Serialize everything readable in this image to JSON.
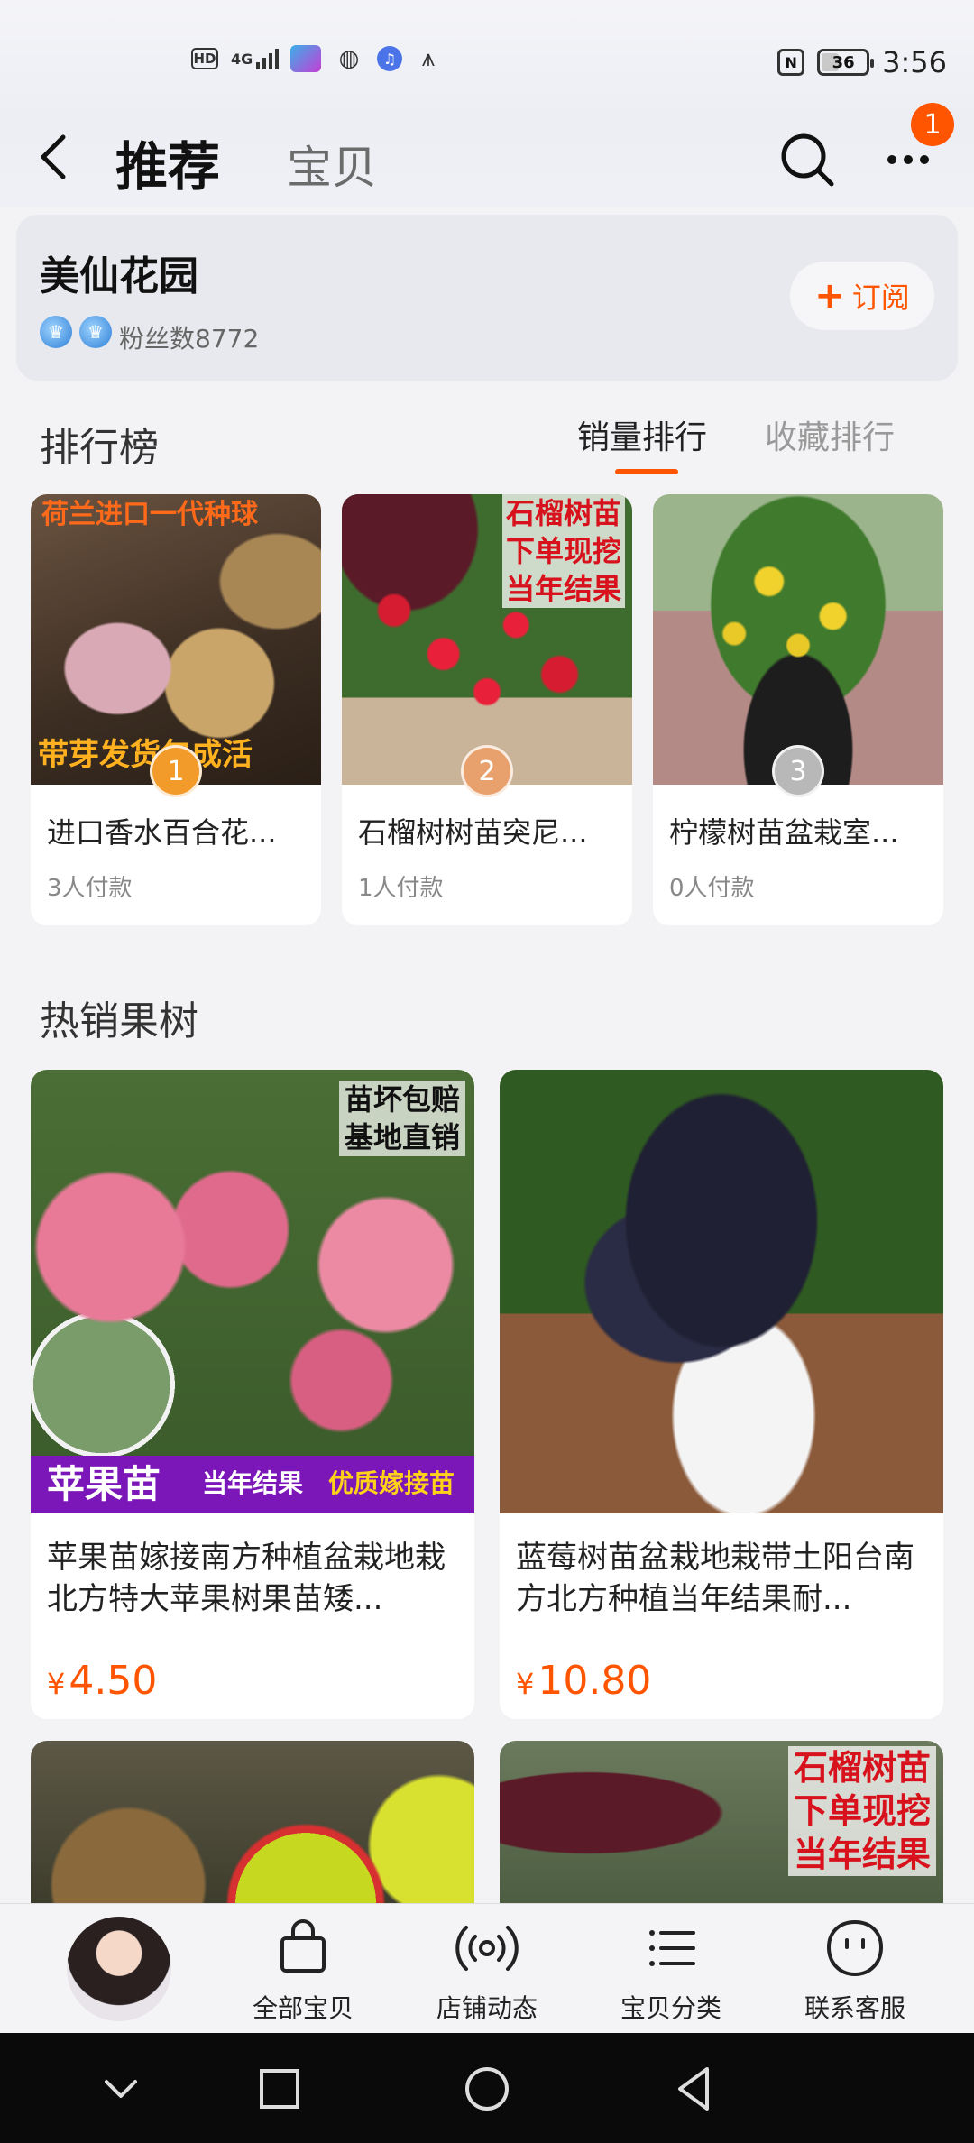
{
  "status_bar": {
    "hd": "HD",
    "network": "4G",
    "nfc": "N",
    "battery": "36",
    "time": "3:56"
  },
  "nav": {
    "tab_recommend": "推荐",
    "tab_items": "宝贝",
    "more_badge": "1"
  },
  "shop": {
    "name": "美仙花园",
    "fans": "粉丝数8772",
    "subscribe_label": "订阅"
  },
  "ranking": {
    "title": "排行榜",
    "tabs": [
      "销量排行",
      "收藏排行"
    ],
    "items": [
      {
        "rank": "1",
        "title": "进口香水百合花...",
        "payers": "3人付款",
        "overlay_top": "荷兰进口一代种球",
        "overlay_bottom": "带芽发货包成活"
      },
      {
        "rank": "2",
        "title": "石榴树树苗突尼...",
        "payers": "1人付款",
        "overlay_lines": [
          "石榴树苗",
          "下单现挖",
          "当年结果"
        ]
      },
      {
        "rank": "3",
        "title": "柠檬树苗盆栽室...",
        "payers": "0人付款"
      }
    ]
  },
  "hot": {
    "title": "热销果树",
    "items": [
      {
        "title": "苹果苗嫁接南方种植盆栽地栽北方特大苹果树果苗矮...",
        "price": "4.50",
        "currency": "¥",
        "overlay_corner": [
          "苗坏包赔",
          "基地直销"
        ],
        "overlay_banner_big": "苹果苗",
        "overlay_banner_small": "当年结果",
        "overlay_banner_yellow": "优质嫁接苗"
      },
      {
        "title": "蓝莓树苗盆栽地栽带土阳台南方北方种植当年结果耐...",
        "price": "10.80",
        "currency": "¥"
      }
    ],
    "partial_overlay": [
      "石榴树苗",
      "下单现挖",
      "当年结果"
    ]
  },
  "toolbar": {
    "items": [
      "全部宝贝",
      "店铺动态",
      "宝贝分类",
      "联系客服"
    ]
  },
  "colors": {
    "accent": "#ff5500",
    "background": "#f3f3f5"
  }
}
